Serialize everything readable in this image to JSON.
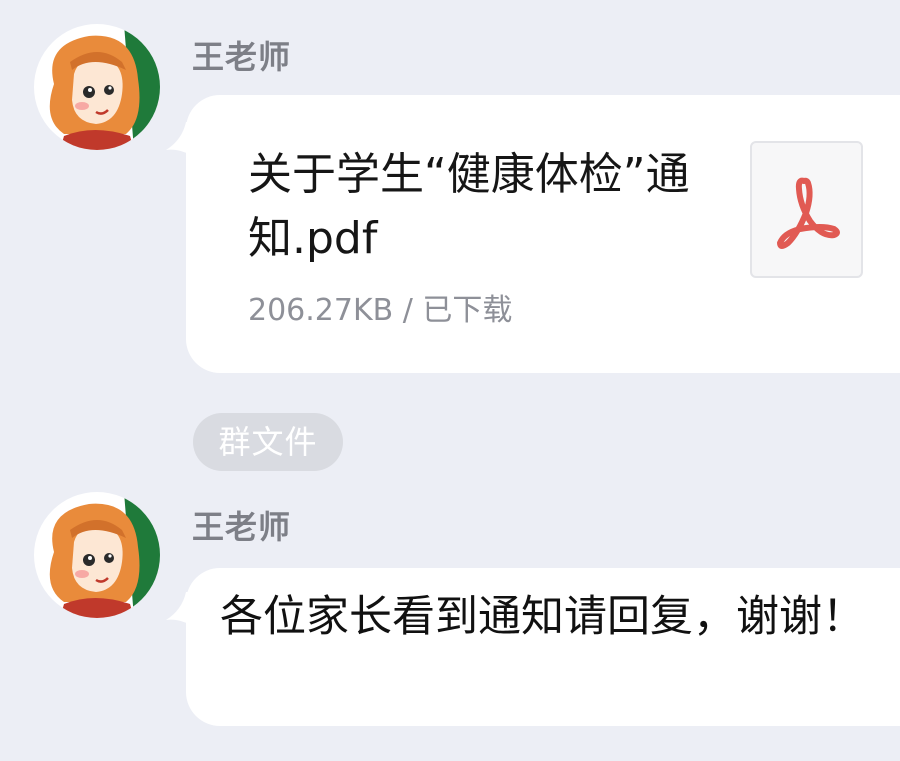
{
  "messages": [
    {
      "sender": "王老师",
      "file": {
        "name": "关于学生“健康体检”通知.pdf",
        "size_status": "206.27KB / 已下载",
        "icon": "pdf-icon"
      }
    },
    {
      "sender": "王老师",
      "text": "各位家长看到通知请回复，谢谢！"
    }
  ],
  "group_file_label": "群文件",
  "colors": {
    "background": "#eceef5",
    "bubble": "#ffffff",
    "pdf_red": "#e15a53",
    "pill_bg": "#d9dbe1"
  }
}
